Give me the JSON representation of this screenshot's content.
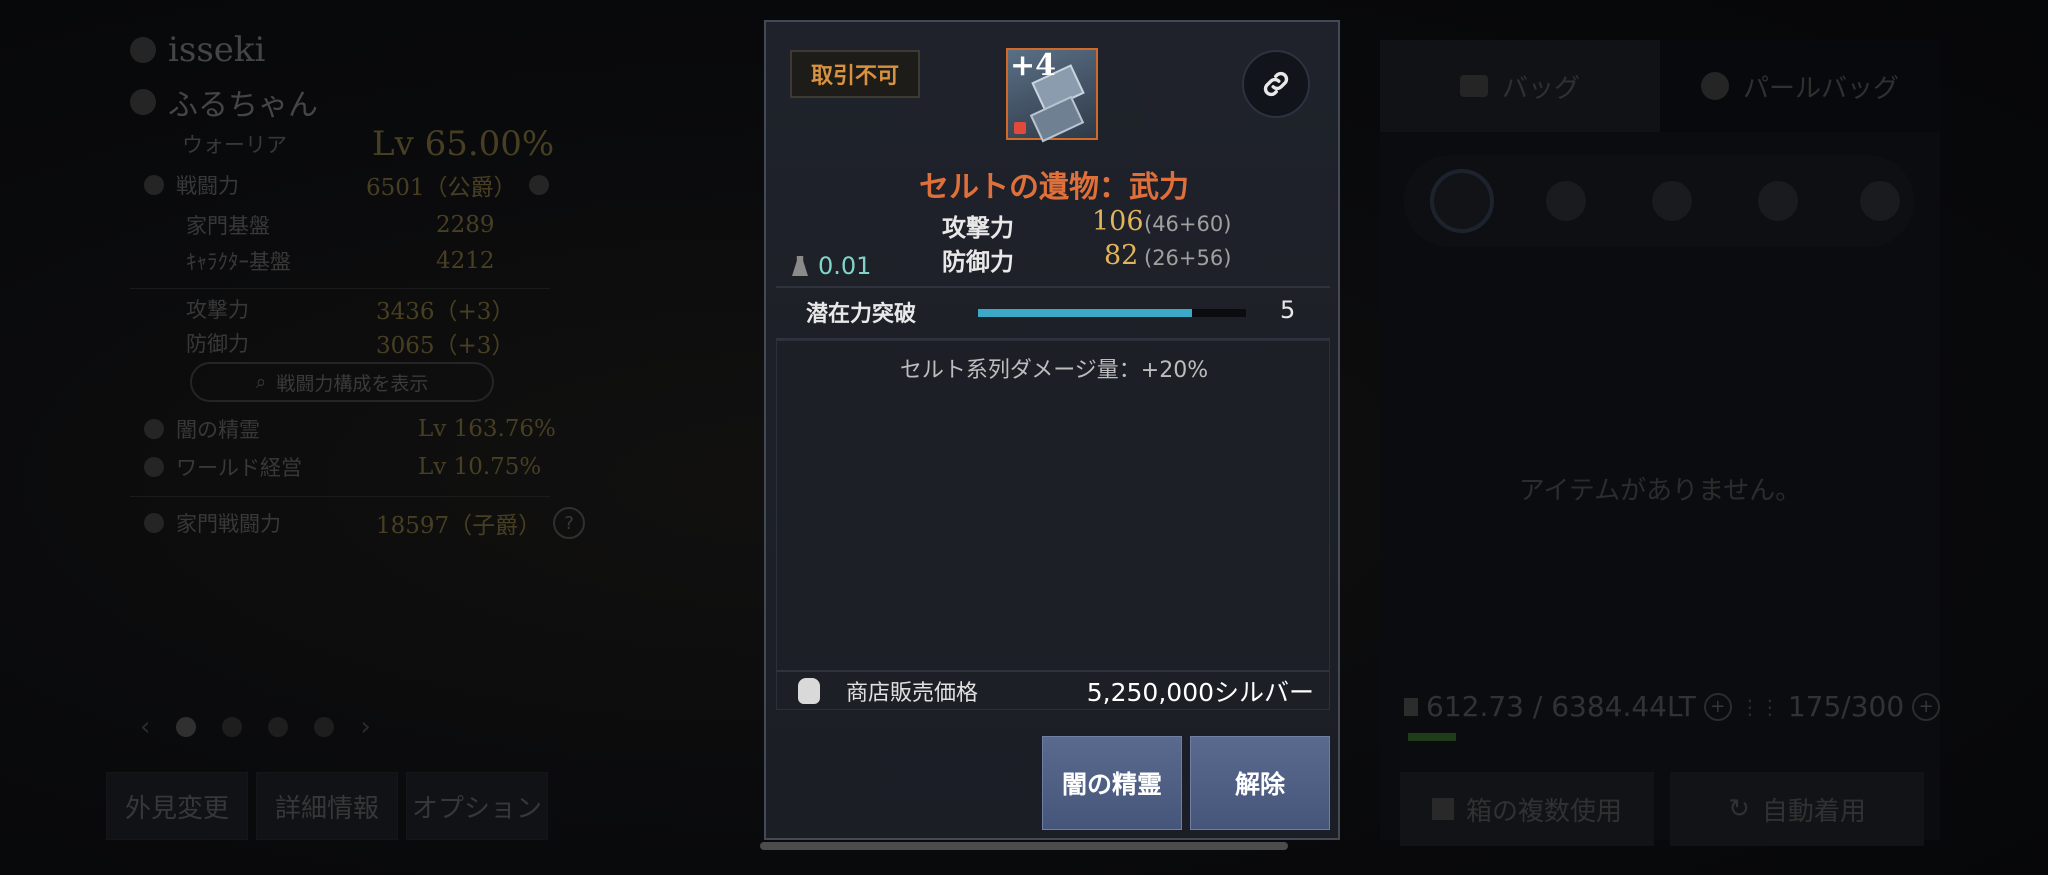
{
  "character": {
    "family_name": "isseki",
    "char_name": "ふるちゃん",
    "class": "ウォーリア",
    "level": "Lv 65.00%",
    "combat_power_label": "戦闘力",
    "combat_power_value": "6501（公爵）",
    "family_base_label": "家門基盤",
    "family_base_value": "2289",
    "char_base_label": "ｷｬﾗｸﾀｰ基盤",
    "char_base_value": "4212",
    "attack_label": "攻撃力",
    "attack_value": "3436（+3）",
    "defense_label": "防御力",
    "defense_value": "3065（+3）",
    "show_combat_btn": "戦闘力構成を表示",
    "dark_spirit_label": "闇の精霊",
    "dark_spirit_value": "Lv 163.76%",
    "world_mgmt_label": "ワールド経営",
    "world_mgmt_value": "Lv 10.75%",
    "family_power_label": "家門戦闘力",
    "family_power_value": "18597（子爵）",
    "help_icon": "?"
  },
  "pager": {
    "prev": "‹",
    "next": "›"
  },
  "bottom_buttons": {
    "appearance": "外見変更",
    "details": "詳細情報",
    "options": "オプション"
  },
  "bag": {
    "tab_bag": "バッグ",
    "tab_pearl": "パールバッグ",
    "empty_text": "アイテムがありません。",
    "weight": "612.73 / 6384.44LT",
    "slots": "175/300",
    "multi_use_btn": "箱の複数使用",
    "auto_equip_btn": "自動着用"
  },
  "tooltip": {
    "tradeable_badge": "取引不可",
    "enhance_level": "+4",
    "item_name": "セルトの遺物：武力",
    "attack_label": "攻撃力",
    "attack_value": "106",
    "attack_breakdown": "(46+60)",
    "defense_label": "防御力",
    "defense_value": "82",
    "defense_breakdown": "(26+56)",
    "weight": "0.01",
    "potential_label": "潜在力突破",
    "potential_value": "5",
    "potential_fraction": 0.8,
    "effect": "セルト系列ダメージ量：+20%",
    "sell_price_label": "商店販売価格",
    "sell_price_value": "5,250,000シルバー",
    "btn_dark_spirit": "闇の精霊",
    "btn_release": "解除"
  },
  "icons": {
    "link": "link-icon",
    "weight": "weight-icon",
    "coin_bag": "coin-bag-icon"
  },
  "colors": {
    "item_name": "#e0703a",
    "badge_text": "#d9923f",
    "stat_value": "#e1b45a",
    "weight_text": "#7fd6c8",
    "progress_fill": "#3aa8c6",
    "button_bg": "#4f5f85"
  }
}
